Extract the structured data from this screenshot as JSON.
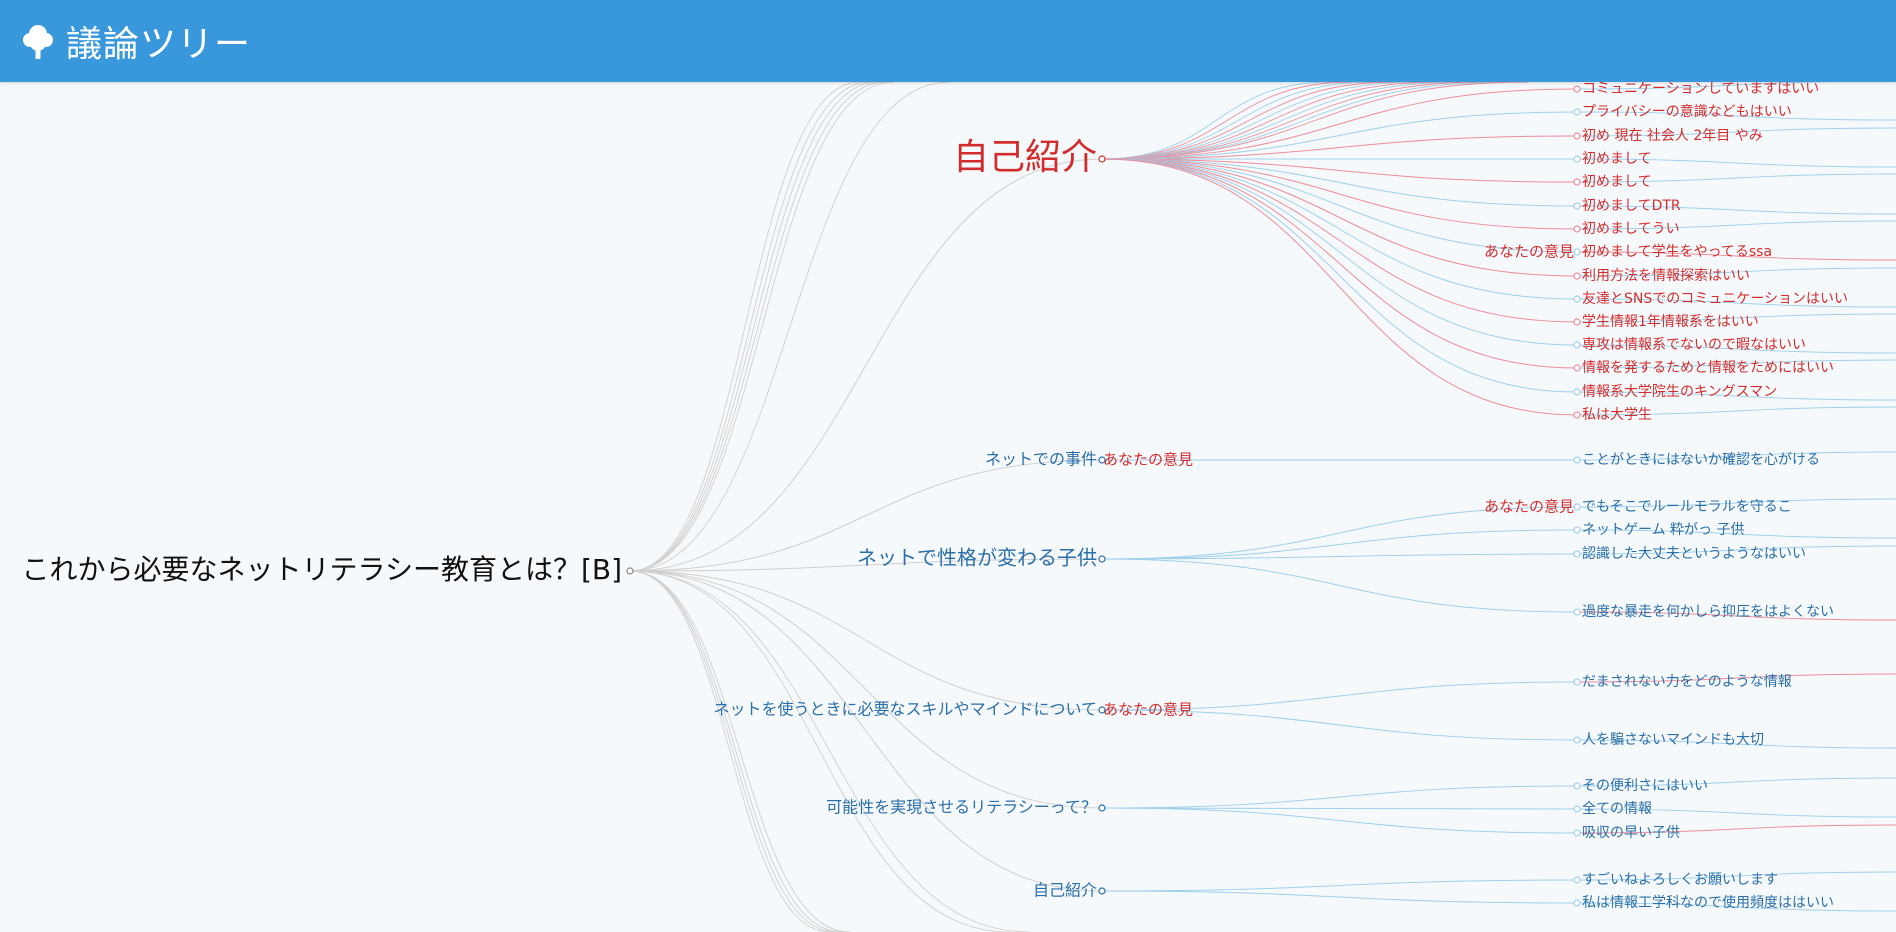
{
  "app": {
    "title": "議論ツリー",
    "icon": "tree-icon"
  },
  "colors": {
    "header": "#3898db",
    "topic_blue": "#2a6fa8",
    "opinion_red": "#d22d2d",
    "link_blue": "#9fd0ea",
    "link_red": "#ec8c98",
    "link_gray": "#cfcfcf"
  },
  "tree": {
    "root": "これから必要なネットリテラシー教育とは？[B]",
    "opinion_tag": "あなたの意見",
    "branches": [
      {
        "label": "自己紹介",
        "color": "red",
        "size": "xl",
        "tag": false,
        "children": [
          {
            "label": "コミュニケーションしていますはいい",
            "color": "red"
          },
          {
            "label": "プライバシーの意識などもはいい",
            "color": "red"
          },
          {
            "label": "初め 現在 社会人 2年目 やみ",
            "color": "red"
          },
          {
            "label": "初めまして",
            "color": "red"
          },
          {
            "label": "初めまして",
            "color": "red"
          },
          {
            "label": "初めましてDTR",
            "color": "red"
          },
          {
            "label": "初めましてうい",
            "color": "red"
          },
          {
            "label": "初めまして学生をやってるssa",
            "color": "red",
            "tag": true
          },
          {
            "label": "利用方法を情報探索はいい",
            "color": "red"
          },
          {
            "label": "友達とSNSでのコミュニケーションはいい",
            "color": "red"
          },
          {
            "label": "学生情報1年情報系をはいい",
            "color": "red"
          },
          {
            "label": "専攻は情報系でないので暇なはいい",
            "color": "red"
          },
          {
            "label": "情報を発するためと情報をためにはいい",
            "color": "red"
          },
          {
            "label": "情報系大学院生のキングスマン",
            "color": "red"
          },
          {
            "label": "私は大学生",
            "color": "red"
          }
        ]
      },
      {
        "label": "ネットでの事件",
        "color": "blue",
        "size": "s",
        "tag": true,
        "children": [
          {
            "label": "ことがときにはないか確認を心がける",
            "color": "blue"
          }
        ]
      },
      {
        "label": "ネットで性格が変わる子供",
        "color": "blue",
        "size": "m",
        "tag": false,
        "children": [
          {
            "label": "でもそこでルールモラルを守るこ",
            "color": "blue",
            "tag": true
          },
          {
            "label": "ネットゲーム 粋がっ 子供",
            "color": "blue"
          },
          {
            "label": "認識した大丈夫というようなはいい",
            "color": "blue"
          },
          {
            "label": "過度な暴走を何かしら抑圧をはよくない",
            "color": "blue"
          }
        ]
      },
      {
        "label": "ネットを使うときに必要なスキルやマインドについて",
        "color": "blue",
        "size": "s",
        "tag": true,
        "children": [
          {
            "label": "だまされない力をどのような情報",
            "color": "blue"
          },
          {
            "label": "人を騙さないマインドも大切",
            "color": "blue"
          }
        ]
      },
      {
        "label": "可能性を実現させるリテラシーって？",
        "color": "blue",
        "size": "s",
        "tag": false,
        "children": [
          {
            "label": "その便利さにはいい",
            "color": "blue"
          },
          {
            "label": "全ての情報",
            "color": "blue"
          },
          {
            "label": "吸収の早い子供",
            "color": "blue"
          }
        ]
      },
      {
        "label": "自己紹介",
        "color": "blue",
        "size": "s",
        "tag": false,
        "children": [
          {
            "label": "すごいねよろしくお願いします",
            "color": "blue"
          },
          {
            "label": "私は情報工学科なので使用頻度ははいい",
            "color": "blue"
          }
        ]
      }
    ]
  }
}
